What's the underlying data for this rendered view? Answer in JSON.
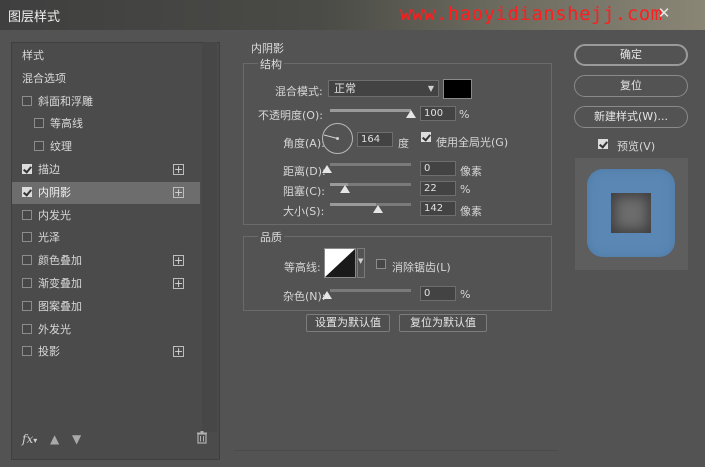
{
  "window": {
    "title": "图层样式",
    "watermark": "www.haoyidianshejj.com"
  },
  "sidebar": {
    "items": [
      {
        "label": "样式",
        "checkbox": null,
        "selected": false,
        "plus": false,
        "indent": 0
      },
      {
        "label": "混合选项",
        "checkbox": null,
        "selected": false,
        "plus": false,
        "indent": 0
      },
      {
        "label": "斜面和浮雕",
        "checkbox": false,
        "selected": false,
        "plus": false,
        "indent": 0
      },
      {
        "label": "等高线",
        "checkbox": false,
        "selected": false,
        "plus": false,
        "indent": 1
      },
      {
        "label": "纹理",
        "checkbox": false,
        "selected": false,
        "plus": false,
        "indent": 1
      },
      {
        "label": "描边",
        "checkbox": true,
        "selected": false,
        "plus": true,
        "indent": 0
      },
      {
        "label": "内阴影",
        "checkbox": true,
        "selected": true,
        "plus": true,
        "indent": 0
      },
      {
        "label": "内发光",
        "checkbox": false,
        "selected": false,
        "plus": false,
        "indent": 0
      },
      {
        "label": "光泽",
        "checkbox": false,
        "selected": false,
        "plus": false,
        "indent": 0
      },
      {
        "label": "颜色叠加",
        "checkbox": false,
        "selected": false,
        "plus": true,
        "indent": 0
      },
      {
        "label": "渐变叠加",
        "checkbox": false,
        "selected": false,
        "plus": true,
        "indent": 0
      },
      {
        "label": "图案叠加",
        "checkbox": false,
        "selected": false,
        "plus": false,
        "indent": 0
      },
      {
        "label": "外发光",
        "checkbox": false,
        "selected": false,
        "plus": false,
        "indent": 0
      },
      {
        "label": "投影",
        "checkbox": false,
        "selected": false,
        "plus": true,
        "indent": 0
      }
    ],
    "fx_label": "fx"
  },
  "inner_shadow": {
    "title": "内阴影",
    "structure": {
      "title": "结构",
      "blend_mode_label": "混合模式:",
      "blend_mode_value": "正常",
      "shadow_color": "#000000",
      "opacity_label": "不透明度(O):",
      "opacity_value": "100",
      "opacity_unit": "%",
      "angle_label": "角度(A):",
      "angle_value": "164",
      "angle_unit": "度",
      "global_light_label": "使用全局光(G)",
      "global_light_checked": true,
      "distance_label": "距离(D):",
      "distance_value": "0",
      "distance_unit": "像素",
      "choke_label": "阻塞(C):",
      "choke_value": "22",
      "choke_unit": "%",
      "size_label": "大小(S):",
      "size_value": "142",
      "size_unit": "像素"
    },
    "quality": {
      "title": "品质",
      "contour_label": "等高线:",
      "antialias_label": "消除锯齿(L)",
      "antialias_checked": false,
      "noise_label": "杂色(N):",
      "noise_value": "0",
      "noise_unit": "%"
    },
    "make_default_label": "设置为默认值",
    "reset_default_label": "复位为默认值"
  },
  "actions": {
    "ok_label": "确定",
    "reset_label": "复位",
    "new_style_label": "新建样式(W)...",
    "preview_label": "预览(V)",
    "preview_checked": true
  },
  "colors": {
    "preview_shape": "#5a87b3",
    "dialog_bg": "#535353"
  }
}
